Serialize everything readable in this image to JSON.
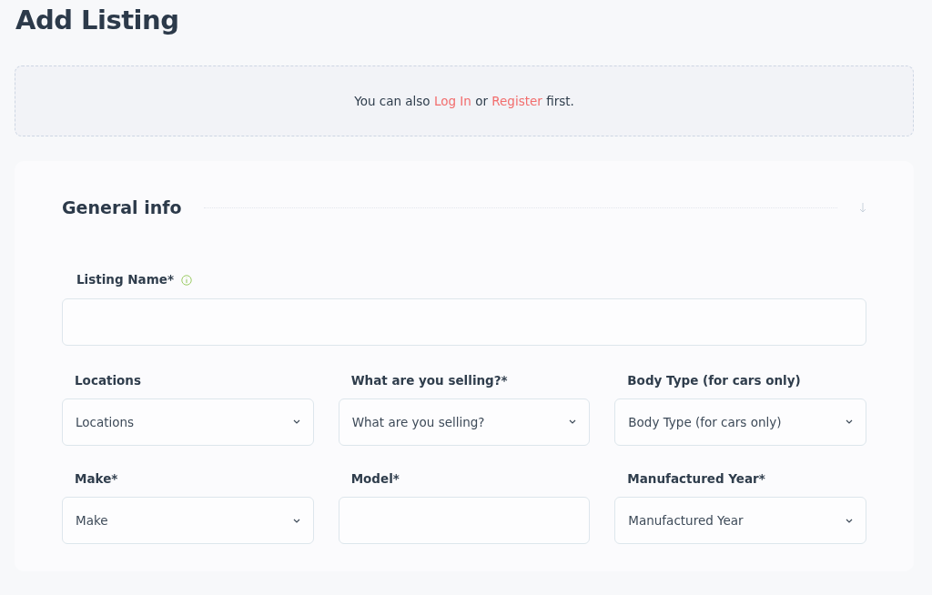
{
  "page_title": "Add Listing",
  "notice": {
    "before": "You can also",
    "login_link": "Log In",
    "middle": "or",
    "register_link": "Register",
    "after": "first."
  },
  "section": {
    "title": "General info",
    "listing_name": {
      "label": "Listing Name*"
    }
  },
  "fields": [
    {
      "kind": "select",
      "label": "Locations",
      "value": "Locations"
    },
    {
      "kind": "select",
      "label": "What are you selling?*",
      "value": "What are you selling?"
    },
    {
      "kind": "select",
      "label": "Body Type (for cars only)",
      "value": "Body Type (for cars only)"
    },
    {
      "kind": "select",
      "label": "Make*",
      "value": "Make"
    },
    {
      "kind": "text",
      "label": "Model*"
    },
    {
      "kind": "select",
      "label": "Manufactured Year*",
      "value": "Manufactured Year"
    }
  ]
}
